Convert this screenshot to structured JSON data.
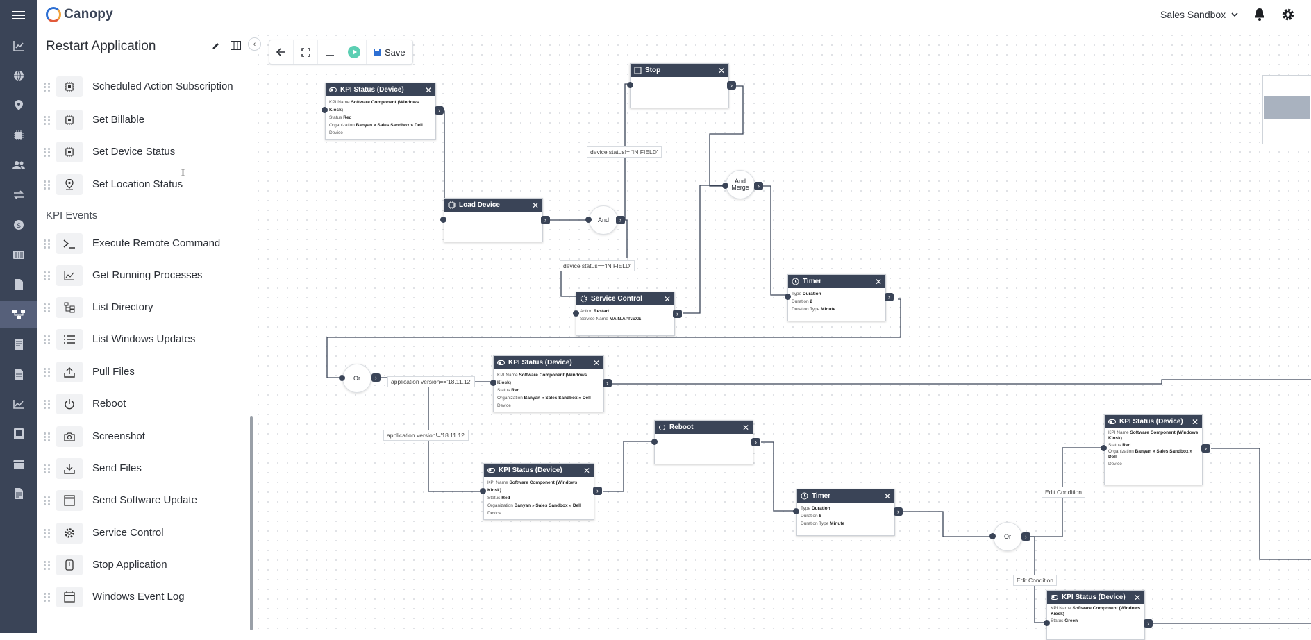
{
  "app": {
    "brand": "Canopy",
    "tenant": "Sales Sandbox"
  },
  "palette": {
    "title": "Restart Application",
    "actions": [
      {
        "label": "Scheduled Action Subscription",
        "icon": "chip-icon"
      },
      {
        "label": "Set Billable",
        "icon": "chip-icon"
      },
      {
        "label": "Set Device Status",
        "icon": "chip-icon"
      },
      {
        "label": "Set Location Status",
        "icon": "location-pin-icon"
      }
    ],
    "section": "KPI Events",
    "kpi_events": [
      {
        "label": "Execute Remote Command",
        "icon": "terminal-icon"
      },
      {
        "label": "Get Running Processes",
        "icon": "line-chart-icon"
      },
      {
        "label": "List Directory",
        "icon": "tree-icon"
      },
      {
        "label": "List Windows Updates",
        "icon": "list-icon"
      },
      {
        "label": "Pull Files",
        "icon": "upload-icon"
      },
      {
        "label": "Reboot",
        "icon": "power-icon"
      },
      {
        "label": "Screenshot",
        "icon": "camera-icon"
      },
      {
        "label": "Send Files",
        "icon": "download-icon"
      },
      {
        "label": "Send Software Update",
        "icon": "window-icon"
      },
      {
        "label": "Service Control",
        "icon": "gear-icon"
      },
      {
        "label": "Stop Application",
        "icon": "phone-icon"
      },
      {
        "label": "Windows Event Log",
        "icon": "calendar-icon"
      }
    ]
  },
  "toolbar": {
    "save_label": "Save"
  },
  "nodes": {
    "kpi1": {
      "title": "KPI Status (Device)",
      "rows": [
        [
          "KPI Name",
          "Software Component (Windows Kiosk)"
        ],
        [
          "Status",
          "Red"
        ],
        [
          "Organization",
          "Banyan » Sales Sandbox » Dell"
        ],
        [
          "Device",
          ""
        ]
      ]
    },
    "stop": {
      "title": "Stop"
    },
    "load": {
      "title": "Load Device"
    },
    "service": {
      "title": "Service Control",
      "rows": [
        [
          "Action",
          "Restart"
        ],
        [
          "Service Name",
          "MAIN.APP.EXE"
        ]
      ]
    },
    "timer1": {
      "title": "Timer",
      "rows": [
        [
          "Type",
          "Duration"
        ],
        [
          "Duration",
          "2"
        ],
        [
          "Duration Type",
          "Minute"
        ]
      ]
    },
    "kpi2": {
      "title": "KPI Status (Device)",
      "rows": [
        [
          "KPI Name",
          "Software Component (Windows Kiosk)"
        ],
        [
          "Status",
          "Red"
        ],
        [
          "Organization",
          "Banyan » Sales Sandbox » Dell"
        ],
        [
          "Device",
          ""
        ]
      ]
    },
    "reboot": {
      "title": "Reboot"
    },
    "kpi3": {
      "title": "KPI Status (Device)",
      "rows": [
        [
          "KPI Name",
          "Software Component (Windows Kiosk)"
        ],
        [
          "Status",
          "Red"
        ],
        [
          "Organization",
          "Banyan » Sales Sandbox » Dell"
        ],
        [
          "Device",
          ""
        ]
      ]
    },
    "timer2": {
      "title": "Timer",
      "rows": [
        [
          "Type",
          "Duration"
        ],
        [
          "Duration",
          "8"
        ],
        [
          "Duration Type",
          "Minute"
        ]
      ]
    },
    "kpi4": {
      "title": "KPI Status (Device)",
      "rows": [
        [
          "KPI Name",
          "Software Component (Windows Kiosk)"
        ],
        [
          "Status",
          "Red"
        ],
        [
          "Organization",
          "Banyan » Sales Sandbox » Dell"
        ],
        [
          "Device",
          ""
        ]
      ]
    },
    "kpi5": {
      "title": "KPI Status (Device)",
      "rows": [
        [
          "KPI Name",
          "Software Component (Windows Kiosk)"
        ],
        [
          "Status",
          "Green"
        ]
      ]
    }
  },
  "gates": {
    "and": "And",
    "and_merge": "And Merge",
    "or1": "Or",
    "or2": "Or"
  },
  "conditions": {
    "c1": "device status!= 'IN FIELD'",
    "c2": "device status=='IN FIELD'",
    "c3": "application version=='18.11.12'",
    "c4": "application version!='18.11.12'",
    "c5": "Edit Condition",
    "c6": "Edit Condition"
  }
}
